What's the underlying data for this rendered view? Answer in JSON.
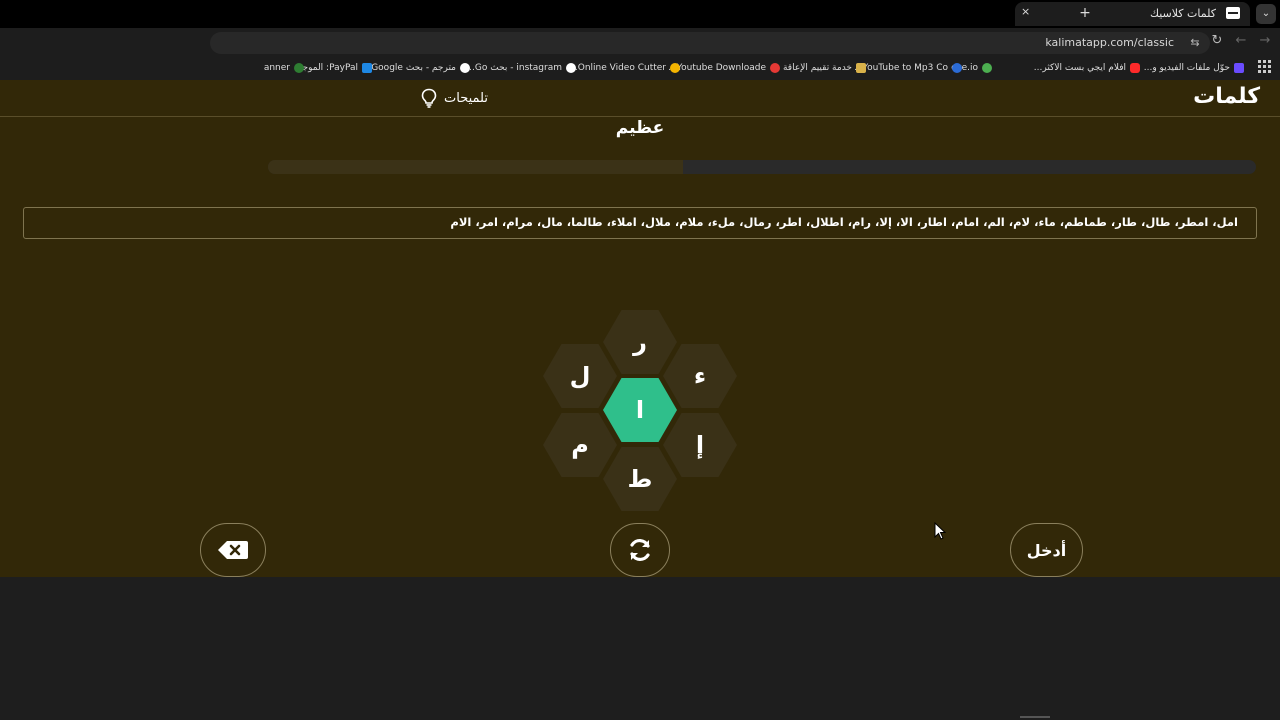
{
  "browser": {
    "tab_title": "كلمات كلاسيك",
    "tab_close": "×",
    "new_tab": "+",
    "tab_menu": "⌄",
    "url": "kalimatapp.com/classic",
    "bookmarks": [
      {
        "label": "حوّل ملفات الفيديو و...",
        "icon_color": "#6a4cff"
      },
      {
        "label": "افلام ايجي بست الاكثر...",
        "icon_color": "#ff2a2a"
      },
      {
        "label": "exe.io",
        "icon_color": "#4caf50"
      },
      {
        "label": "YouTube to Mp3 Co...",
        "icon_color": "#2b6bd6"
      },
      {
        "label": "خدمة تقييم الإعاقة",
        "icon_color": "#d9b24a"
      },
      {
        "label": "Youtube Downloade...",
        "icon_color": "#e53935"
      },
      {
        "label": "Online Video Cutter...",
        "icon_color": "#f4b400"
      },
      {
        "label": "instagram - بحث Go...",
        "icon_color": "#ffffff"
      },
      {
        "label": "مترجم - بحث Google",
        "icon_color": "#ffffff"
      },
      {
        "label": "PayPal: الموجز",
        "icon_color": "#1e88e5"
      },
      {
        "label": "anner",
        "icon_color": "#2e7d32"
      }
    ]
  },
  "app": {
    "logo": "كلمات",
    "hints_label": "تلميحات",
    "rank": "عظيم",
    "progress": 0.42,
    "found_words": "امل، امطر، طال، طار، طماطم، ماء، لام، الم، امام، اطار، الا، إلا، رام، اطلال، اطر، رمال، ملء، ملام، ملال، املاء، طالما، مال، مرام، امر، الام",
    "letters": {
      "center": "ا",
      "top": "ر",
      "top_right": "ء",
      "bottom_right": "إ",
      "bottom": "ط",
      "bottom_left": "م",
      "top_left": "ل"
    },
    "enter_label": "أدخل",
    "colors": {
      "background": "#322808",
      "accent": "#2fbf8b",
      "hex": "#3a3117"
    }
  }
}
